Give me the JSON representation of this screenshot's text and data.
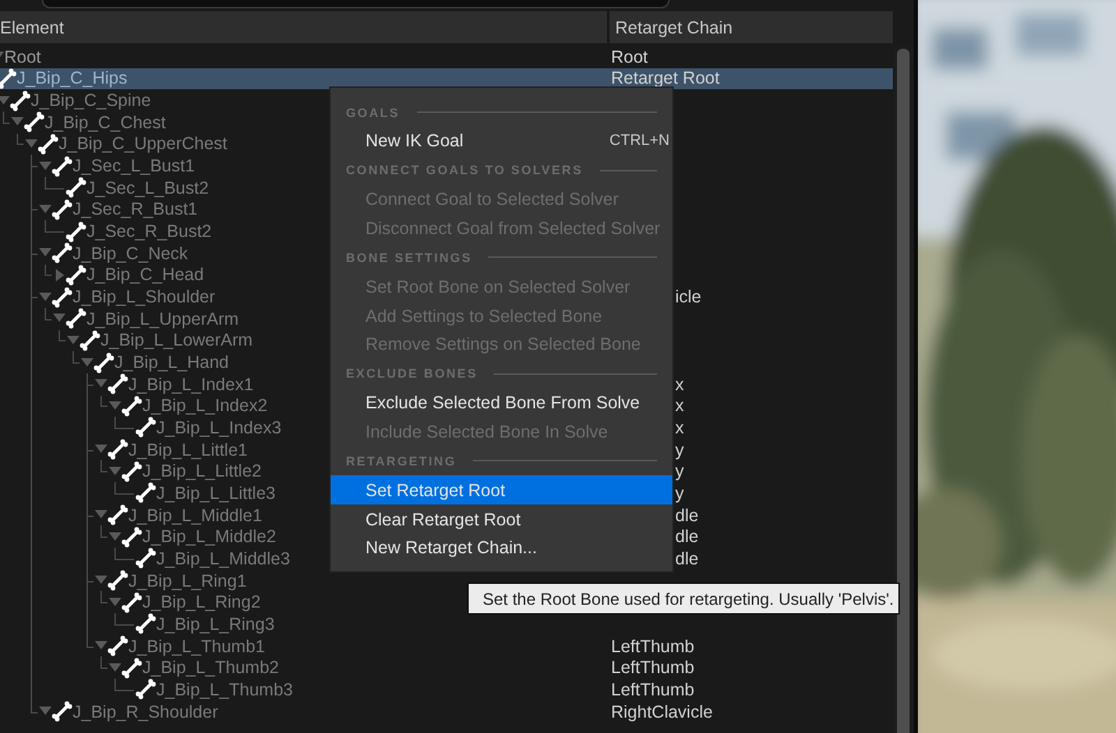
{
  "columns": [
    {
      "label": "Element"
    },
    {
      "label": "Retarget Chain"
    }
  ],
  "tree": {
    "name": "Root",
    "kind": "root",
    "expanded": true,
    "selected": false,
    "chain": "Root",
    "children": [
      {
        "name": "J_Bip_C_Hips",
        "kind": "bone",
        "selected": true,
        "chain": "Retarget Root",
        "children": [
          {
            "name": "J_Bip_C_Spine",
            "kind": "bone",
            "expanded": true,
            "selected": false,
            "children": [
              {
                "name": "J_Bip_C_Chest",
                "kind": "bone",
                "expanded": true,
                "selected": false,
                "children": [
                  {
                    "name": "J_Bip_C_UpperChest",
                    "kind": "bone",
                    "expanded": true,
                    "selected": false,
                    "children": [
                      {
                        "name": "J_Sec_L_Bust1",
                        "kind": "bone",
                        "expanded": true,
                        "selected": false,
                        "children": [
                          {
                            "name": "J_Sec_L_Bust2",
                            "kind": "bone",
                            "selected": false
                          }
                        ]
                      },
                      {
                        "name": "J_Sec_R_Bust1",
                        "kind": "bone",
                        "expanded": true,
                        "selected": false,
                        "children": [
                          {
                            "name": "J_Sec_R_Bust2",
                            "kind": "bone",
                            "selected": false
                          }
                        ]
                      },
                      {
                        "name": "J_Bip_C_Neck",
                        "kind": "bone",
                        "expanded": true,
                        "selected": false,
                        "children": [
                          {
                            "name": "J_Bip_C_Head",
                            "kind": "bone",
                            "expanded": false,
                            "selected": false
                          }
                        ]
                      },
                      {
                        "name": "J_Bip_L_Shoulder",
                        "kind": "bone",
                        "expanded": true,
                        "selected": false,
                        "chain": "icle",
                        "clipped": true,
                        "children": [
                          {
                            "name": "J_Bip_L_UpperArm",
                            "kind": "bone",
                            "expanded": true,
                            "selected": false,
                            "children": [
                              {
                                "name": "J_Bip_L_LowerArm",
                                "kind": "bone",
                                "expanded": true,
                                "selected": false,
                                "children": [
                                  {
                                    "name": "J_Bip_L_Hand",
                                    "kind": "bone",
                                    "expanded": true,
                                    "selected": false,
                                    "children": [
                                      {
                                        "name": "J_Bip_L_Index1",
                                        "kind": "bone",
                                        "expanded": true,
                                        "selected": false,
                                        "chain": "x",
                                        "clipped": true,
                                        "children": [
                                          {
                                            "name": "J_Bip_L_Index2",
                                            "kind": "bone",
                                            "expanded": true,
                                            "selected": false,
                                            "chain": "x",
                                            "clipped": true,
                                            "children": [
                                              {
                                                "name": "J_Bip_L_Index3",
                                                "kind": "bone",
                                                "selected": false,
                                                "chain": "x",
                                                "clipped": true
                                              }
                                            ]
                                          }
                                        ]
                                      },
                                      {
                                        "name": "J_Bip_L_Little1",
                                        "kind": "bone",
                                        "expanded": true,
                                        "selected": false,
                                        "chain": "y",
                                        "clipped": true,
                                        "children": [
                                          {
                                            "name": "J_Bip_L_Little2",
                                            "kind": "bone",
                                            "expanded": true,
                                            "selected": false,
                                            "chain": "y",
                                            "clipped": true,
                                            "children": [
                                              {
                                                "name": "J_Bip_L_Little3",
                                                "kind": "bone",
                                                "selected": false,
                                                "chain": "y",
                                                "clipped": true
                                              }
                                            ]
                                          }
                                        ]
                                      },
                                      {
                                        "name": "J_Bip_L_Middle1",
                                        "kind": "bone",
                                        "expanded": true,
                                        "selected": false,
                                        "chain": "dle",
                                        "clipped": true,
                                        "children": [
                                          {
                                            "name": "J_Bip_L_Middle2",
                                            "kind": "bone",
                                            "expanded": true,
                                            "selected": false,
                                            "chain": "dle",
                                            "clipped": true,
                                            "children": [
                                              {
                                                "name": "J_Bip_L_Middle3",
                                                "kind": "bone",
                                                "selected": false,
                                                "chain": "dle",
                                                "clipped": true
                                              }
                                            ]
                                          }
                                        ]
                                      },
                                      {
                                        "name": "J_Bip_L_Ring1",
                                        "kind": "bone",
                                        "expanded": true,
                                        "selected": false,
                                        "children": [
                                          {
                                            "name": "J_Bip_L_Ring2",
                                            "kind": "bone",
                                            "expanded": true,
                                            "selected": false,
                                            "children": [
                                              {
                                                "name": "J_Bip_L_Ring3",
                                                "kind": "bone",
                                                "selected": false
                                              }
                                            ]
                                          }
                                        ]
                                      },
                                      {
                                        "name": "J_Bip_L_Thumb1",
                                        "kind": "bone",
                                        "expanded": true,
                                        "selected": false,
                                        "chain": "LeftThumb",
                                        "children": [
                                          {
                                            "name": "J_Bip_L_Thumb2",
                                            "kind": "bone",
                                            "expanded": true,
                                            "selected": false,
                                            "chain": "LeftThumb",
                                            "children": [
                                              {
                                                "name": "J_Bip_L_Thumb3",
                                                "kind": "bone",
                                                "selected": false,
                                                "chain": "LeftThumb"
                                              }
                                            ]
                                          }
                                        ]
                                      }
                                    ]
                                  }
                                ]
                              }
                            ]
                          }
                        ]
                      },
                      {
                        "name": "J_Bip_R_Shoulder",
                        "kind": "bone",
                        "expanded": true,
                        "selected": false,
                        "chain": "RightClavicle"
                      }
                    ]
                  }
                ]
              }
            ]
          }
        ]
      }
    ]
  },
  "menu": {
    "sections": [
      {
        "title": "GOALS",
        "items": [
          {
            "label": "New IK Goal",
            "shortcut": "CTRL+N",
            "disabled": false,
            "selected": false
          }
        ]
      },
      {
        "title": "CONNECT GOALS TO SOLVERS",
        "items": [
          {
            "label": "Connect Goal to Selected Solver",
            "disabled": true,
            "selected": false
          },
          {
            "label": "Disconnect Goal from Selected Solver",
            "disabled": true,
            "selected": false
          }
        ]
      },
      {
        "title": "BONE SETTINGS",
        "items": [
          {
            "label": "Set Root Bone on Selected Solver",
            "disabled": true,
            "selected": false
          },
          {
            "label": "Add Settings to Selected Bone",
            "disabled": true,
            "selected": false
          },
          {
            "label": "Remove Settings on Selected Bone",
            "disabled": true,
            "selected": false
          }
        ]
      },
      {
        "title": "EXCLUDE BONES",
        "items": [
          {
            "label": "Exclude Selected Bone From Solve",
            "disabled": false,
            "selected": false
          },
          {
            "label": "Include Selected Bone In Solve",
            "disabled": true,
            "selected": false
          }
        ]
      },
      {
        "title": "RETARGETING",
        "items": [
          {
            "label": "Set Retarget Root",
            "disabled": false,
            "selected": true
          },
          {
            "label": "Clear Retarget Root",
            "disabled": false,
            "selected": false
          },
          {
            "label": "New Retarget Chain...",
            "disabled": false,
            "selected": false
          }
        ]
      }
    ]
  },
  "tooltip": "Set the Root Bone used for retargeting. Usually 'Pelvis'."
}
